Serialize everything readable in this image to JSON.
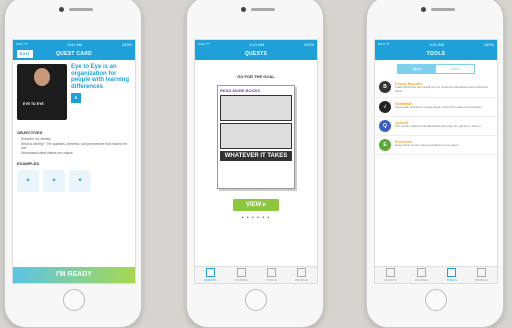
{
  "status": {
    "carrier": "••••• ᯤ",
    "time": "9:41 AM",
    "battery": "100%"
  },
  "screen1": {
    "exit_label": "EXIT",
    "title": "QUEST CARD",
    "shirt_text": "EYE TO EYE",
    "hero_text": "Eye to Eye is an organization for people with learning differences",
    "logo_text": "E",
    "objectives_heading": "OBJECTIVES",
    "objectives": [
      "Describe my identity",
      "What is Identity? The qualities, interests, and perspective that makes me, me!",
      "Understand what makes me unique"
    ],
    "examples_heading": "EXAMPLES",
    "ready_label": "I'M READY"
  },
  "screen2": {
    "title": "QUESTS",
    "goal": "GO FOR THE GOAL",
    "comic_title": "READ MORE BOOKS",
    "comic_banner": "WHATEVER IT TAKES",
    "view_label": "VIEW ▸",
    "dots": "• • • • • •",
    "tabs": [
      "QUESTS",
      "JOURNAL",
      "TOOLS",
      "PROFILE"
    ]
  },
  "screen3": {
    "title": "TOOLS",
    "seg": [
      "Apps",
      "Web"
    ],
    "tools": [
      {
        "name": "Focus Booster",
        "desc": "Track work time and break time to minimize distractions and maximize focus",
        "icon": "B",
        "color": "#333333"
      },
      {
        "name": "ModMath",
        "desc": "Type math problems to keep track of all of the steps and numbers",
        "icon": "√",
        "color": "#222222"
      },
      {
        "name": "Quizlet",
        "desc": "Turn study material into flashcards and play fun games to learn it",
        "icon": "Q",
        "color": "#3b5fc0"
      },
      {
        "name": "Evernote",
        "desc": "Keep track of your notes and ideas in one place",
        "icon": "E",
        "color": "#5aa83a"
      }
    ],
    "tabs": [
      "QUESTS",
      "JOURNAL",
      "TOOLS",
      "PROFILE"
    ]
  }
}
